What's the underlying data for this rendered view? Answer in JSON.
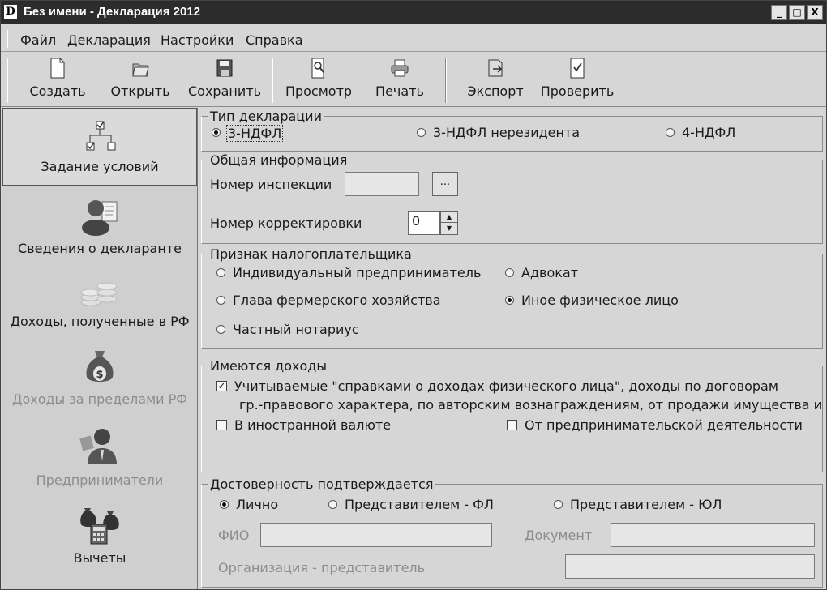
{
  "window": {
    "app_icon": "D",
    "title": "Без имени - Декларация 2012",
    "controls": [
      "_",
      "□",
      "X"
    ]
  },
  "menu": [
    "Файл",
    "Декларация",
    "Настройки",
    "Справка"
  ],
  "toolbar": {
    "create": "Создать",
    "open": "Открыть",
    "save": "Сохранить",
    "preview": "Просмотр",
    "print": "Печать",
    "export": "Экспорт",
    "check": "Проверить"
  },
  "sidebar": [
    {
      "label": "Задание условий",
      "icon": "tree-checklist-icon",
      "selected": true
    },
    {
      "label": "Сведения о декларанте",
      "icon": "person-document-icon"
    },
    {
      "label": "Доходы, полученные в РФ",
      "icon": "coins-stack-icon"
    },
    {
      "label": "Доходы за пределами РФ",
      "icon": "money-bag-icon",
      "disabled": true
    },
    {
      "label": "Предприниматели",
      "icon": "businessman-icon",
      "disabled": true
    },
    {
      "label": "Вычеты",
      "icon": "calculator-bags-icon"
    }
  ],
  "declaration_type": {
    "legend": "Тип декларации",
    "options": [
      "3-НДФЛ",
      "3-НДФЛ нерезидента",
      "4-НДФЛ"
    ],
    "selected": "3-НДФЛ"
  },
  "general_info": {
    "legend": "Общая информация",
    "inspection_label": "Номер инспекции",
    "inspection_value": "",
    "browse_label": "...",
    "correction_label": "Номер корректировки",
    "correction_value": "0"
  },
  "taxpayer": {
    "legend": "Признак налогоплательщика",
    "options": [
      "Индивидуальный предприниматель",
      "Адвокат",
      "Глава фермерского хозяйства",
      "Иное физическое лицо",
      "Частный нотариус"
    ],
    "selected": "Иное физическое лицо"
  },
  "income": {
    "legend": "Имеются доходы",
    "item1_line1": "Учитываемые \"справками о доходах физического лица\", доходы по договорам",
    "item1_line2": "гр.-правового характера, по авторским вознаграждениям, от продажи имущества и др.",
    "item1_checked": true,
    "foreign_currency": "В иностранной валюте",
    "foreign_checked": false,
    "business": "От предпринимательской деятельности",
    "business_checked": false
  },
  "confirmation": {
    "legend": "Достоверность подтверждается",
    "options": [
      "Лично",
      "Представителем - ФЛ",
      "Представителем - ЮЛ"
    ],
    "selected": "Лично",
    "fio_label": "ФИО",
    "document_label": "Документ",
    "org_label": "Организация - представитель"
  }
}
